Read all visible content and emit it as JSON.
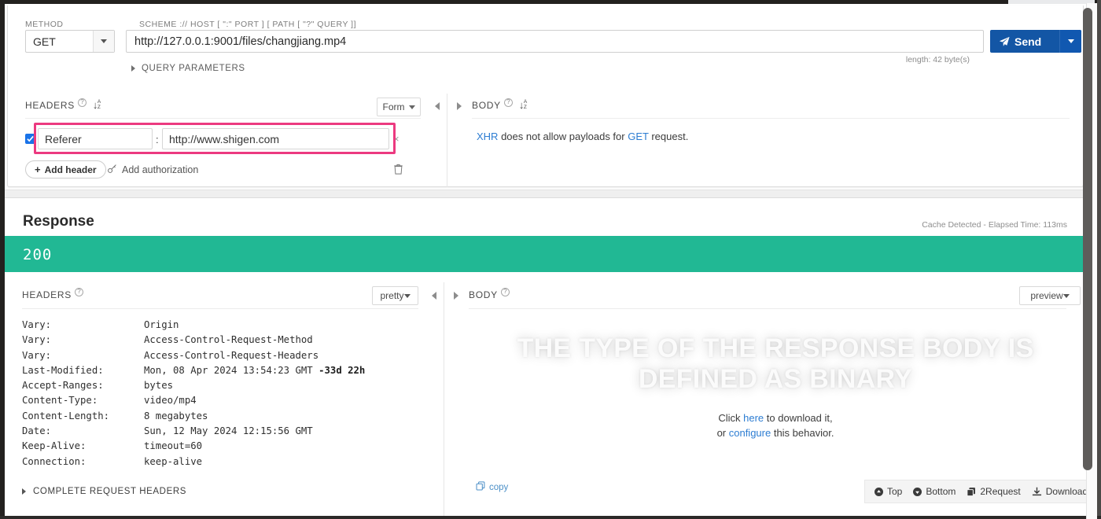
{
  "request": {
    "method_label": "METHOD",
    "method_value": "GET",
    "url_label": "SCHEME :// HOST [ \":\" PORT ] [ PATH [ \"?\" QUERY ]]",
    "url_value": "http://127.0.0.1:9001/files/changjiang.mp4",
    "url_length": "length: 42 byte(s)",
    "send_label": "Send",
    "query_parameters_label": "QUERY PARAMETERS",
    "headers_label": "HEADERS",
    "form_select_value": "Form",
    "header_row": {
      "name": "Referer",
      "colon": ":",
      "value": "http://www.shigen.com",
      "remove_label": "×",
      "checked": true
    },
    "add_header_label": "Add header",
    "add_header_plus": "+",
    "add_authorization_label": "Add authorization",
    "body_label": "BODY",
    "xhr_note": {
      "link1": "XHR",
      "mid": " does not allow payloads for ",
      "link2": "GET",
      "tail": " request."
    }
  },
  "response": {
    "title": "Response",
    "cache_info": "Cache Detected - Elapsed Time: 113ms",
    "status_code": "200",
    "status_color": "#21b894",
    "headers_label": "HEADERS",
    "body_label": "BODY",
    "pretty_select_value": "pretty",
    "preview_select_value": "preview",
    "complete_request_headers_label": "COMPLETE REQUEST HEADERS",
    "copy_label": "copy",
    "headers": [
      {
        "key": "Vary:",
        "value": "Origin"
      },
      {
        "key": "Vary:",
        "value": "Access-Control-Request-Method"
      },
      {
        "key": "Vary:",
        "value": "Access-Control-Request-Headers"
      },
      {
        "key": "Last-Modified:",
        "value": "Mon, 08 Apr 2024 13:54:23 GMT",
        "value_style": "blue",
        "suffix": "-33d 22h"
      },
      {
        "key": "Accept-Ranges:",
        "value": "bytes"
      },
      {
        "key": "Content-Type:",
        "value": "video/mp4"
      },
      {
        "key": "Content-Length:",
        "value": "8 megabytes"
      },
      {
        "key": "Date:",
        "value": "Sun, 12 May 2024 12:15:56 GMT"
      },
      {
        "key": "Keep-Alive:",
        "value": "timeout=60"
      },
      {
        "key": "Connection:",
        "value": "keep-alive"
      }
    ],
    "body_watermark": "THE TYPE OF THE RESPONSE BODY IS DEFINED AS BINARY",
    "body_note": {
      "line1_pre": "Click ",
      "line1_link": "here",
      "line1_post": " to download it,",
      "line2_pre": "or ",
      "line2_link": "configure",
      "line2_post": " this behavior."
    },
    "toolbar": [
      {
        "label": "Top",
        "icon": "arrow-up-circle-icon"
      },
      {
        "label": "Bottom",
        "icon": "arrow-down-circle-icon"
      },
      {
        "label": "2Request",
        "icon": "copy-icon"
      },
      {
        "label": "Download",
        "icon": "download-icon"
      }
    ]
  },
  "colors": {
    "accent_blue": "#1356a5",
    "link_blue": "#2d7dd2",
    "highlight_pink": "#ec3a80",
    "status_green": "#21b894"
  }
}
